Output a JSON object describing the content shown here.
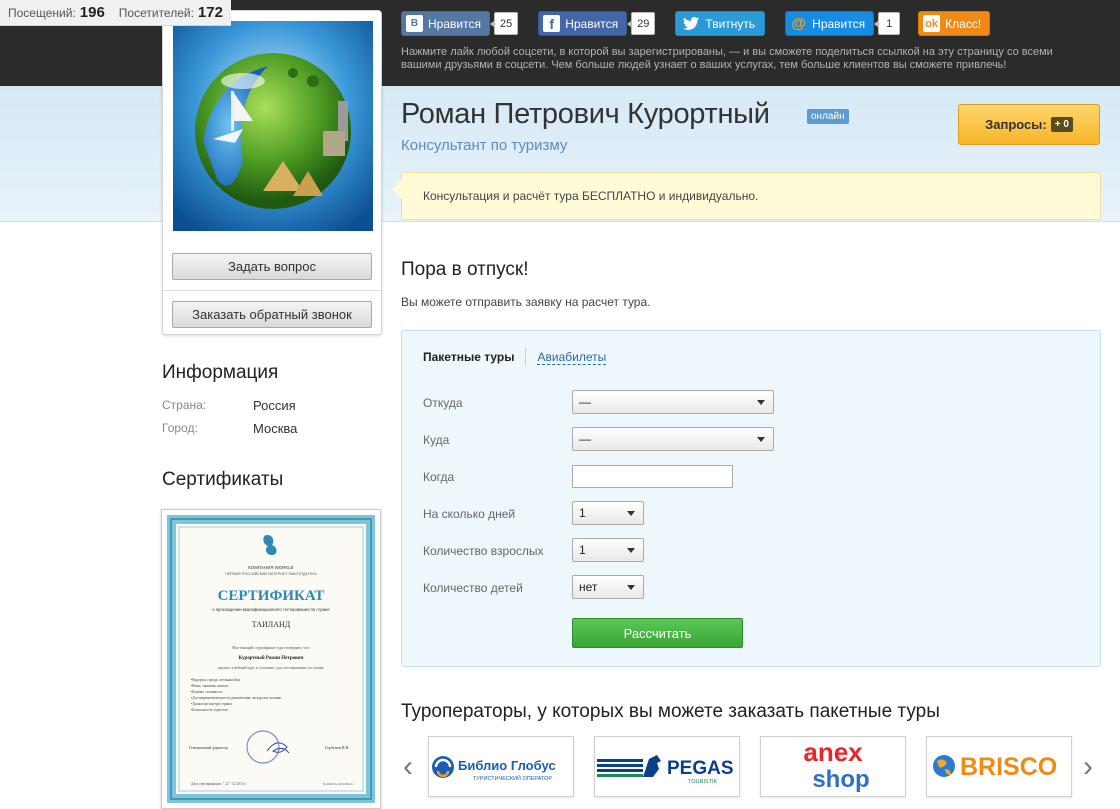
{
  "counters": {
    "visits_label": "Посещений:",
    "visits": "196",
    "visitors_label": "Посетителей:",
    "visitors": "172"
  },
  "social": {
    "vk_label": "Нравится",
    "vk_count": "25",
    "fb_label": "Нравится",
    "fb_count": "29",
    "tw_label": "Твитнуть",
    "mr_label": "Нравится",
    "mr_count": "1",
    "ok_label": "Класс!",
    "note": "Нажмите лайк любой соцсети, в которой вы зарегистрированы, — и вы сможете поделиться ссылкой на эту страницу со всеми вашими друзьями в соцсети. Чем больше людей узнает о ваших услугах, тем больше клиентов вы сможете привлечь!"
  },
  "profile": {
    "name": "Роман Петрович Курортный",
    "status": "онлайн",
    "role": "Консультант по туризму",
    "requests_label": "Запросы:",
    "requests_count": "+ 0",
    "notice": "Консультация и расчёт тура БЕСПЛАТНО и индивидуально."
  },
  "left": {
    "ask_button": "Задать вопрос",
    "callback_button": "Заказать обратный звонок",
    "info_title": "Информация",
    "country_label": "Страна:",
    "country": "Россия",
    "city_label": "Город:",
    "city": "Москва",
    "certs_title": "Сертификаты"
  },
  "certificate": {
    "company": "КОМПАНИЯ WORKLE",
    "company_sub": "ПЕРВЫЙ РОССИЙСКИЙ ИНТЕРНЕТ-РАБОТОДАТЕЛЬ",
    "title": "СЕРТИФИКАТ",
    "subtitle": "о прохождении квалификационного тестирования по стране",
    "country": "ТАИЛАНД",
    "line1": "Настоящий сертификат удостоверяет, что",
    "holder": "Курортный Роман Петрович",
    "line2": "прошел учебный курс и успешно сдал тестирование по темам:",
    "topics": [
      "•Курорты, города, отельная база",
      "•Визы, таможня, валюта",
      "•Климат, сезонность",
      "•Достопримечательности, развлечения, экскурсии, шопинг",
      "•Транспорт внутри страны",
      "•Безопасность туристов"
    ],
    "sign_role": "Генеральный директор",
    "sign_name": "Горбунов В.Н.",
    "date_line": "Дата сертификации: \" 22 \" 12 2013 г.",
    "number": "№ КМ-ТА-3251080-0.1"
  },
  "form": {
    "heading": "Пора в отпуск!",
    "sub": "Вы можете отправить заявку на расчет тура.",
    "tab_packages": "Пакетные туры",
    "tab_flights": "Авиабилеты",
    "from_label": "Откуда",
    "from_value": "—",
    "to_label": "Куда",
    "to_value": "—",
    "when_label": "Когда",
    "days_label": "На сколько дней",
    "days_value": "1",
    "adults_label": "Количество взрослых",
    "adults_value": "1",
    "kids_label": "Количество детей",
    "kids_value": "нет",
    "submit": "Рассчитать"
  },
  "operators": {
    "heading": "Туроператоры, у которых вы можете заказать пакетные туры",
    "items": [
      {
        "name": "Библио Глобус",
        "sub": "ТУРИСТИЧЕСКИЙ ОПЕРАТОР"
      },
      {
        "name": "PEGAS",
        "sub": "TOURISTIK"
      },
      {
        "name": "anex",
        "sub": "shop"
      },
      {
        "name": "BRISCO",
        "sub": ""
      }
    ]
  }
}
